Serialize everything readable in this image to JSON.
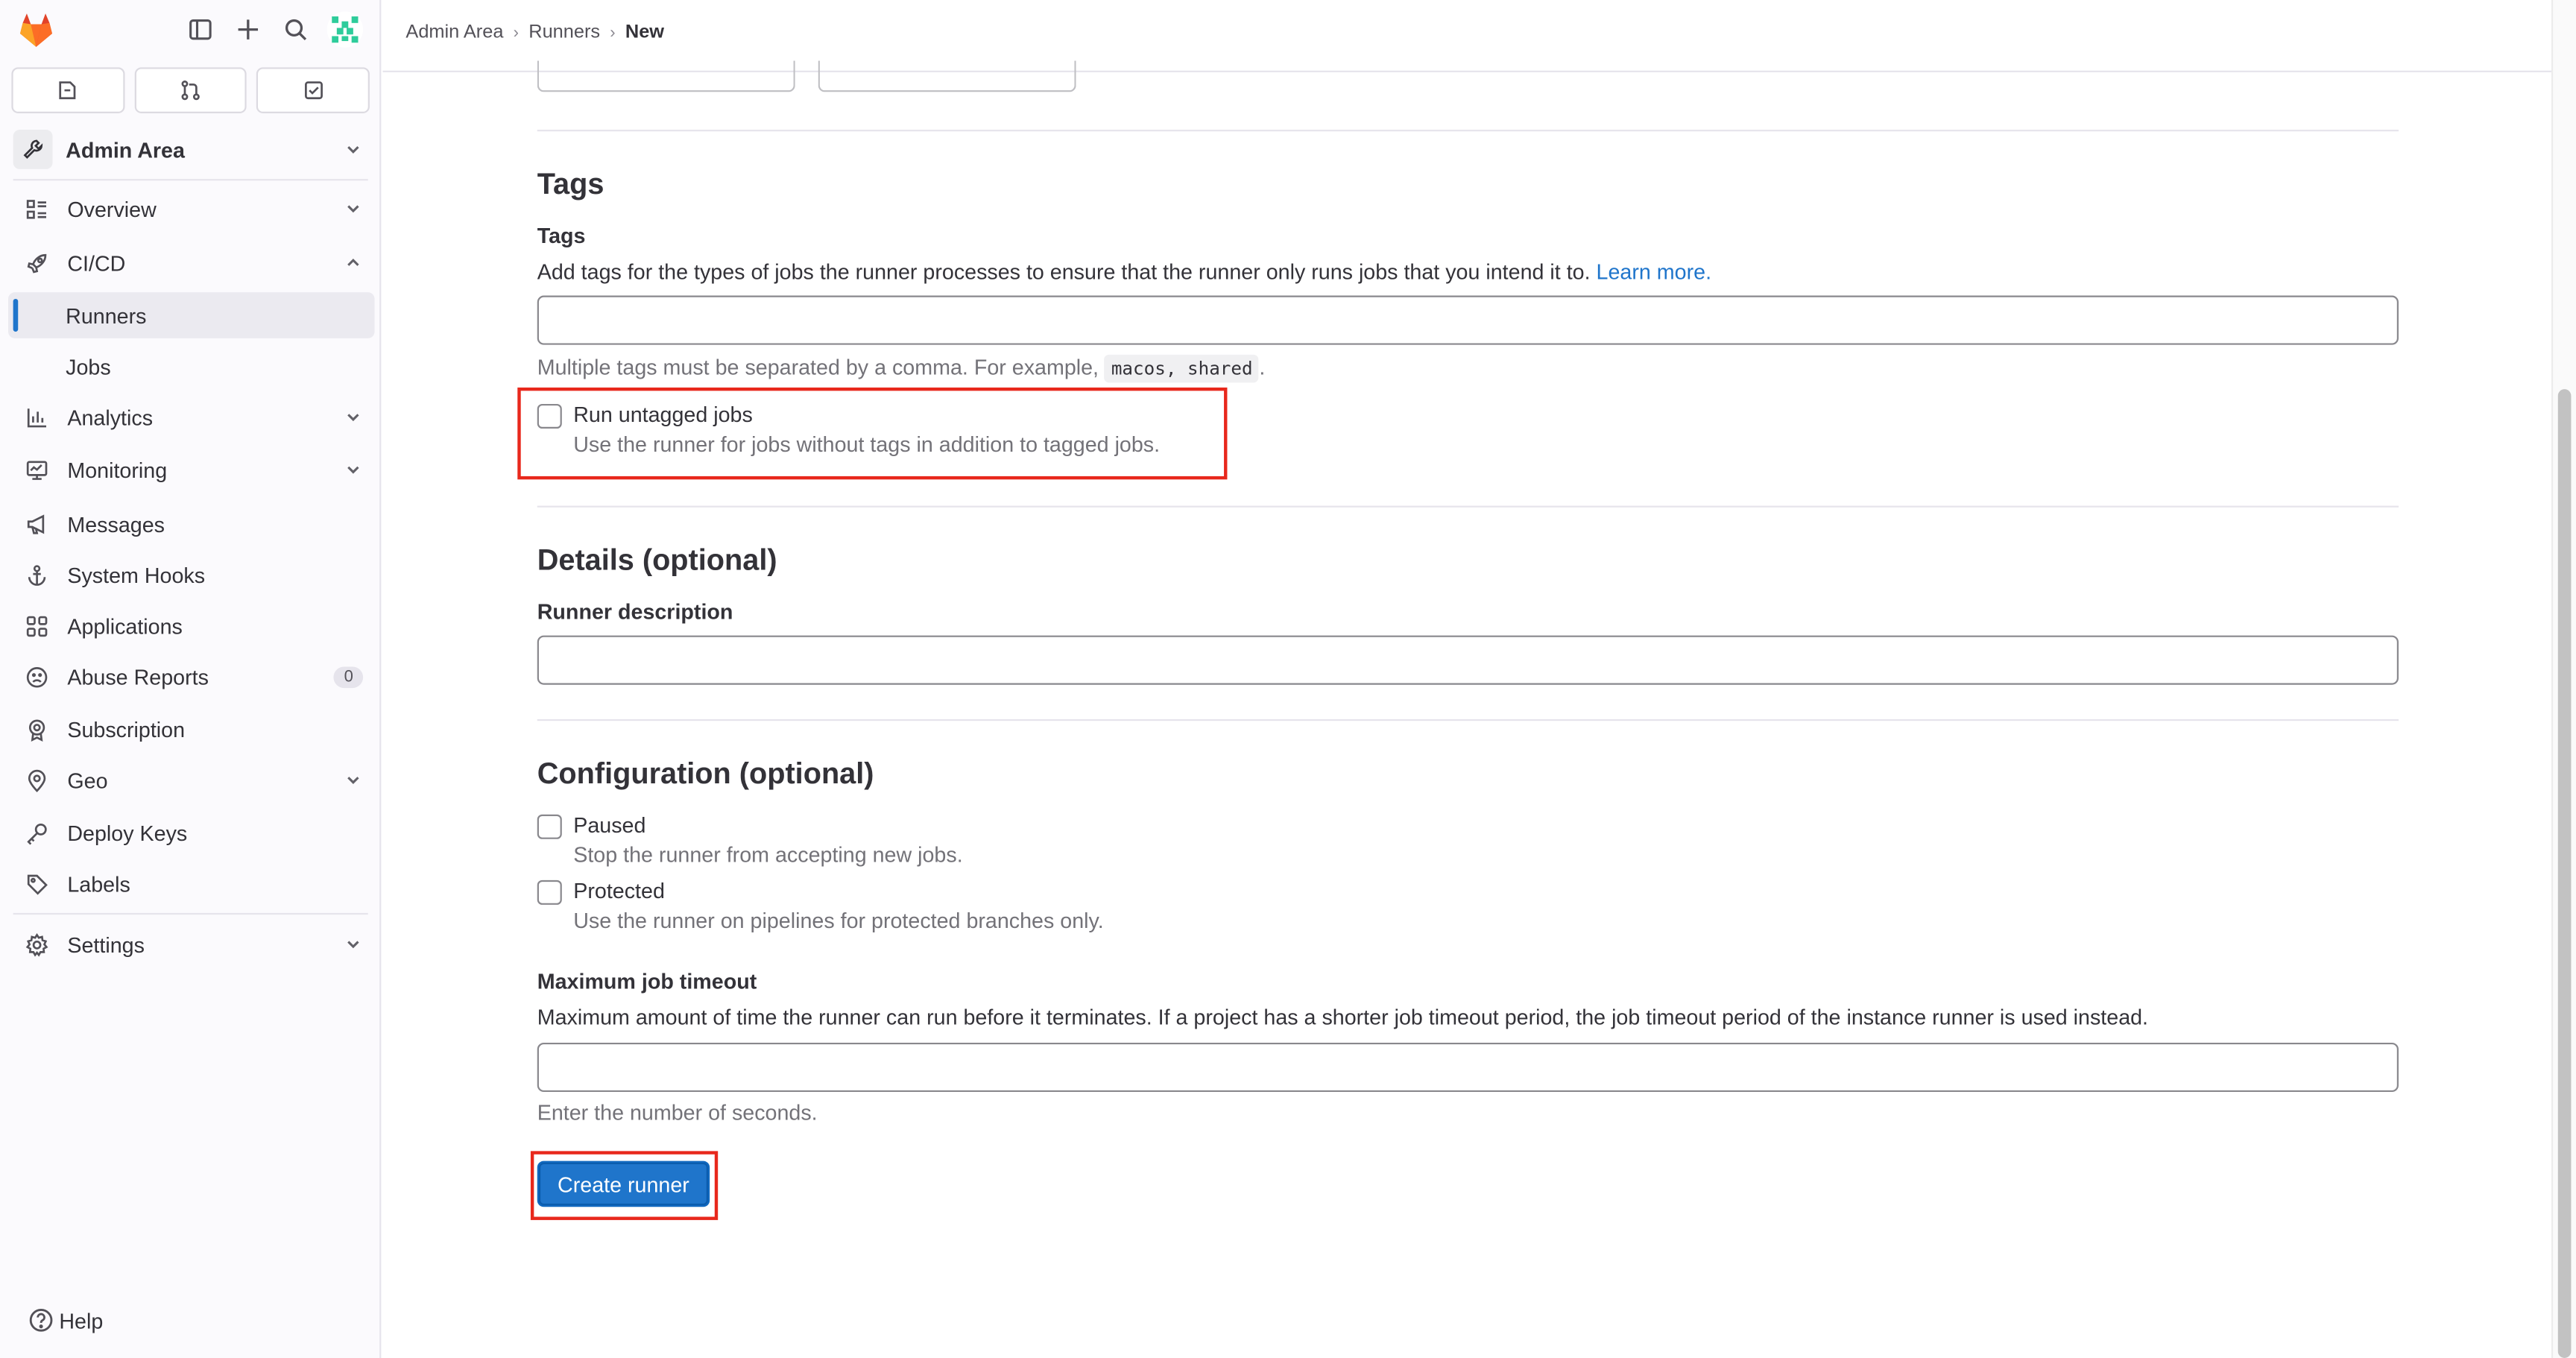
{
  "colors": {
    "brand_orange": "#fc6d26",
    "accent_blue": "#1f75cb",
    "highlight_red": "#e8281c",
    "sidebar_bg": "#fbfafd"
  },
  "sidebar": {
    "top_icons": [
      "gitlab-logo",
      "sidebar-toggle-icon",
      "plus-icon",
      "search-icon",
      "user-avatar"
    ],
    "tabs": [
      {
        "name": "issues-tab",
        "icon": "issues-icon"
      },
      {
        "name": "merge-requests-tab",
        "icon": "merge-request-icon"
      },
      {
        "name": "todos-tab",
        "icon": "todo-icon"
      }
    ],
    "context_label": "Admin Area",
    "items": [
      {
        "label": "Overview",
        "icon": "overview-icon",
        "expandable": true
      },
      {
        "label": "CI/CD",
        "icon": "rocket-icon",
        "expanded": true
      },
      {
        "label": "Runners",
        "active": true
      },
      {
        "label": "Jobs"
      },
      {
        "label": "Analytics",
        "icon": "chart-icon",
        "expandable": true
      },
      {
        "label": "Monitoring",
        "icon": "monitor-icon",
        "expandable": true
      },
      {
        "label": "Messages",
        "icon": "bullhorn-icon"
      },
      {
        "label": "System Hooks",
        "icon": "anchor-icon"
      },
      {
        "label": "Applications",
        "icon": "apps-icon"
      },
      {
        "label": "Abuse Reports",
        "icon": "abuse-icon",
        "badge": "0"
      },
      {
        "label": "Subscription",
        "icon": "subscription-icon"
      },
      {
        "label": "Geo",
        "icon": "location-icon",
        "expandable": true
      },
      {
        "label": "Deploy Keys",
        "icon": "key-icon"
      },
      {
        "label": "Labels",
        "icon": "label-icon"
      },
      {
        "label": "Settings",
        "icon": "settings-icon",
        "expandable": true
      }
    ],
    "help_label": "Help"
  },
  "breadcrumb": [
    "Admin Area",
    "Runners",
    "New"
  ],
  "tags_section": {
    "heading": "Tags",
    "field_label": "Tags",
    "description": "Add tags for the types of jobs the runner processes to ensure that the runner only runs jobs that you intend it to.",
    "learn_more": "Learn more.",
    "input_value": "",
    "hint_prefix": "Multiple tags must be separated by a comma. For example,",
    "hint_code": "macos, shared",
    "hint_suffix": ".",
    "untagged_label": "Run untagged jobs",
    "untagged_help": "Use the runner for jobs without tags in addition to tagged jobs.",
    "untagged_checked": false
  },
  "details_section": {
    "heading": "Details (optional)",
    "field_label": "Runner description",
    "input_value": ""
  },
  "configuration_section": {
    "heading": "Configuration (optional)",
    "paused_label": "Paused",
    "paused_help": "Stop the runner from accepting new jobs.",
    "paused_checked": false,
    "protected_label": "Protected",
    "protected_help": "Use the runner on pipelines for protected branches only.",
    "protected_checked": false,
    "timeout_label": "Maximum job timeout",
    "timeout_description": "Maximum amount of time the runner can run before it terminates. If a project has a shorter job timeout period, the job timeout period of the instance runner is used instead.",
    "timeout_value": "",
    "timeout_hint": "Enter the number of seconds."
  },
  "submit_button": "Create runner"
}
